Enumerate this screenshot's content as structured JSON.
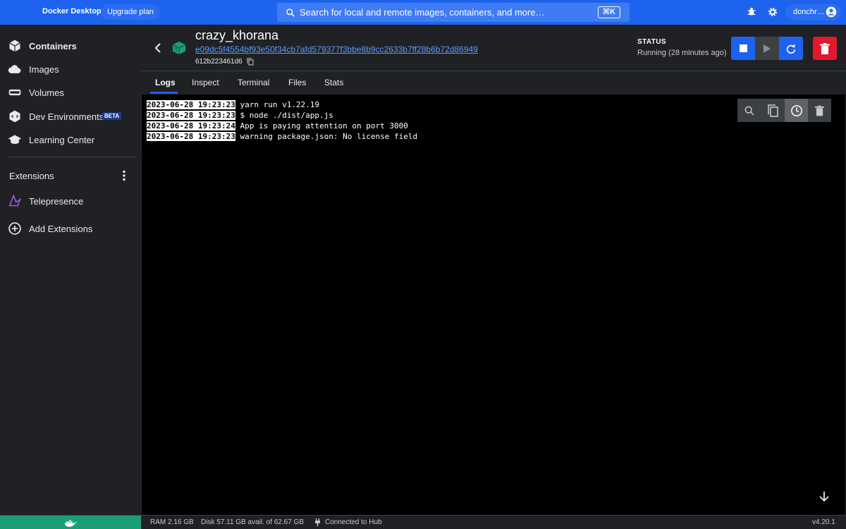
{
  "app": {
    "title": "Docker Desktop",
    "upgrade_label": "Upgrade plan"
  },
  "search": {
    "placeholder": "Search for local and remote images, containers, and more…",
    "shortcut": "⌘K"
  },
  "user": {
    "name": "donchr…"
  },
  "sidebar": {
    "items": [
      {
        "label": "Containers",
        "icon": "containers-icon",
        "active": true
      },
      {
        "label": "Images",
        "icon": "images-icon"
      },
      {
        "label": "Volumes",
        "icon": "volumes-icon"
      },
      {
        "label": "Dev Environments",
        "icon": "dev-environments-icon",
        "badge": "BETA"
      },
      {
        "label": "Learning Center",
        "icon": "learning-center-icon"
      }
    ],
    "extensions_header": "Extensions",
    "extensions": [
      {
        "label": "Telepresence",
        "icon": "telepresence-icon"
      },
      {
        "label": "Add Extensions",
        "icon": "add-circle-icon"
      }
    ]
  },
  "container": {
    "name": "crazy_khorana",
    "id": "e09dc5f4554bf93e50f34cb7afd579377f3bbe8b9cc2633b7ff28b6b72d86949",
    "short_id": "612b223461d6",
    "status_title": "STATUS",
    "status_value": "Running (28 minutes ago)"
  },
  "tabs": [
    "Logs",
    "Inspect",
    "Terminal",
    "Files",
    "Stats"
  ],
  "active_tab": "Logs",
  "logs": [
    {
      "ts": "2023-06-28 19:23:23",
      "msg": " yarn run v1.22.19"
    },
    {
      "ts": "2023-06-28 19:23:23",
      "msg": " $ node ./dist/app.js"
    },
    {
      "ts": "2023-06-28 19:23:24",
      "msg": " App is paying attention on port 3000"
    },
    {
      "ts": "2023-06-28 19:23:23",
      "msg": " warning package.json: No license field"
    }
  ],
  "footer": {
    "ram": "RAM 2.16 GB",
    "disk": "Disk 57.11 GB avail. of 62.67 GB",
    "hub": "Connected to Hub",
    "version": "v4.20.1"
  },
  "colors": {
    "accent": "#1d63ed",
    "danger": "#e0192e",
    "engine_running": "#1b9e77"
  }
}
